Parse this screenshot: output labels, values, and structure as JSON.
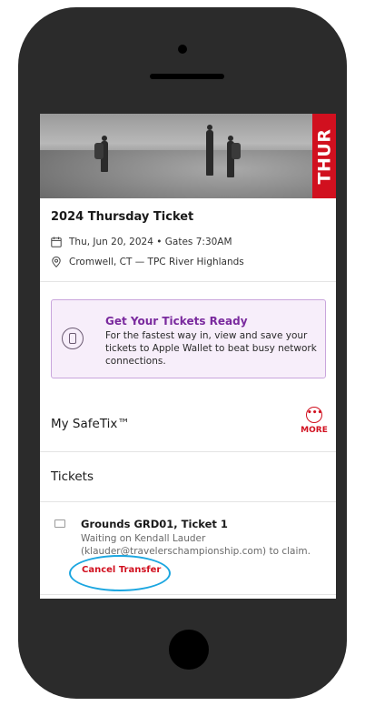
{
  "hero": {
    "day_badge": "THUR"
  },
  "event": {
    "title": "2024 Thursday Ticket",
    "date_line": "Thu, Jun 20, 2024 • Gates 7:30AM",
    "location_line": "Cromwell, CT — TPC River Highlands",
    "date_icon": "calendar-icon",
    "location_icon": "location-pin-icon"
  },
  "wallet": {
    "title": "Get Your Tickets Ready",
    "body": "For the fastest way in, view and save your tickets to Apple Wallet to beat busy network connections.",
    "icon": "phone-wallet-icon"
  },
  "safetix": {
    "title": "My SafeTix™",
    "more_label": "MORE",
    "more_icon": "more-dots-icon"
  },
  "tickets": {
    "section_title": "Tickets",
    "items": [
      {
        "title": "Grounds GRD01, Ticket 1",
        "status": "Waiting on Kendall Lauder (klauder@travelerschampionship.com) to claim.",
        "action": "Cancel Transfer",
        "icon": "ticket-icon"
      }
    ]
  },
  "colors": {
    "accent_red": "#d1101f",
    "wallet_purple": "#7a2a9e",
    "annotation_blue": "#1ba6e0",
    "device_body": "#2b2b2b"
  }
}
